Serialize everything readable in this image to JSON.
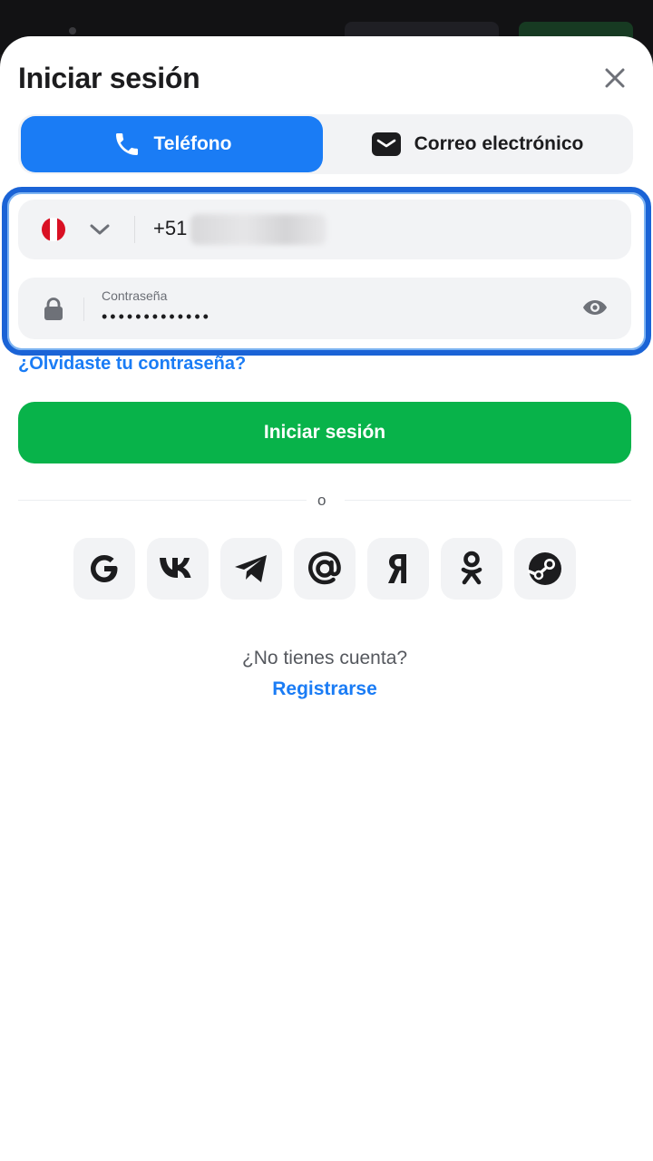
{
  "header": {
    "title": "Iniciar sesión"
  },
  "tabs": [
    {
      "label": "Teléfono",
      "icon": "phone-icon",
      "active": true
    },
    {
      "label": "Correo electrónico",
      "icon": "mail-icon",
      "active": false
    }
  ],
  "phone": {
    "country": "Peru",
    "flag_colors": [
      "#d91023",
      "#ffffff",
      "#d91023"
    ],
    "prefix": "+51",
    "number_hidden": true
  },
  "password": {
    "label": "Contraseña",
    "value_masked": "•••••••••••••"
  },
  "forgot_label": "¿Olvidaste tu contraseña?",
  "login_label": "Iniciar sesión",
  "divider_label": "o",
  "social": [
    {
      "name": "google",
      "icon": "google-icon"
    },
    {
      "name": "vk",
      "icon": "vk-icon"
    },
    {
      "name": "telegram",
      "icon": "telegram-icon"
    },
    {
      "name": "mail",
      "icon": "at-icon"
    },
    {
      "name": "yandex",
      "icon": "yandex-icon"
    },
    {
      "name": "odnoklassniki",
      "icon": "odnoklassniki-icon"
    },
    {
      "name": "steam",
      "icon": "steam-icon"
    }
  ],
  "footer": {
    "no_account": "¿No tienes cuenta?",
    "register": "Registrarse"
  },
  "colors": {
    "accent": "#1a7cf5",
    "primary_button": "#08b34a",
    "field_bg": "#f2f3f5"
  }
}
